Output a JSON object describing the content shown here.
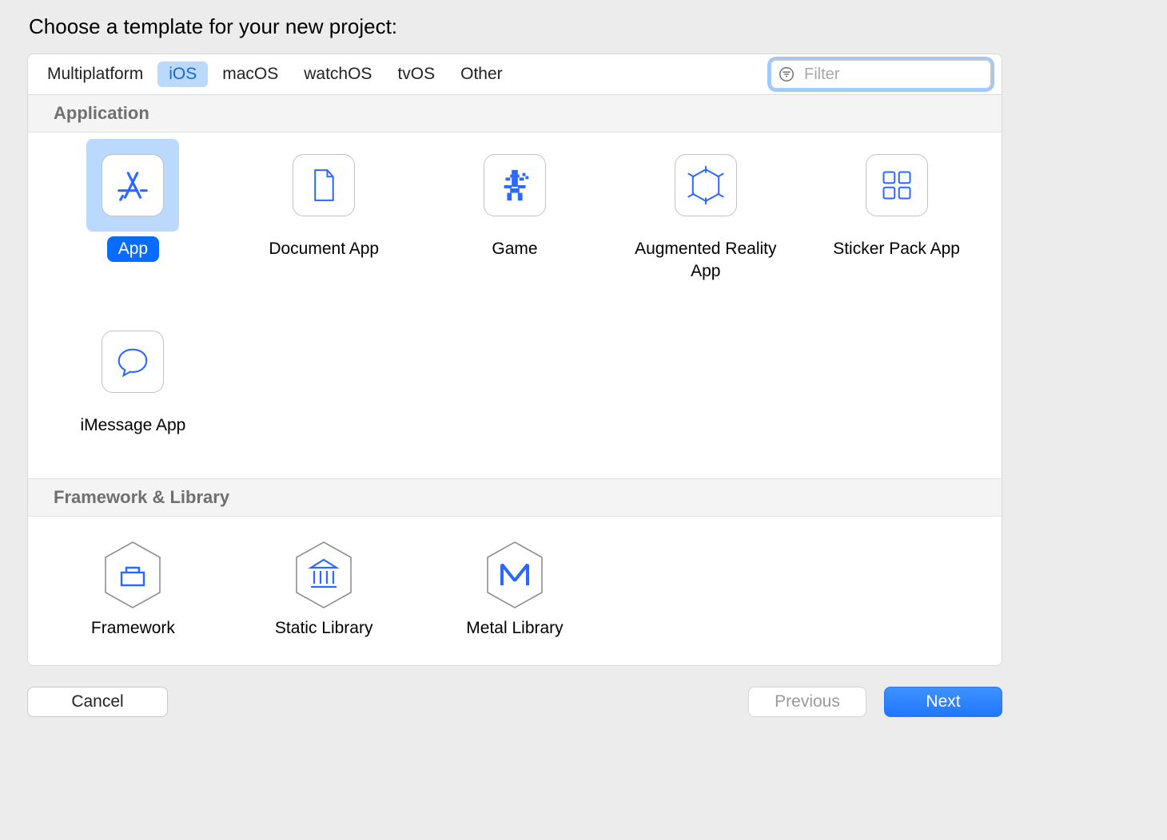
{
  "title": "Choose a template for your new project:",
  "tabs": [
    "Multiplatform",
    "iOS",
    "macOS",
    "watchOS",
    "tvOS",
    "Other"
  ],
  "active_tab_index": 1,
  "filter": {
    "placeholder": "Filter",
    "value": ""
  },
  "sections": {
    "application": {
      "title": "Application",
      "items": [
        {
          "label": "App",
          "icon": "app-store-icon",
          "selected": true
        },
        {
          "label": "Document App",
          "icon": "document-icon"
        },
        {
          "label": "Game",
          "icon": "game-icon"
        },
        {
          "label": "Augmented Reality App",
          "icon": "ar-icon"
        },
        {
          "label": "Sticker Pack App",
          "icon": "grid-icon"
        },
        {
          "label": "iMessage App",
          "icon": "chat-icon"
        }
      ]
    },
    "framework": {
      "title": "Framework & Library",
      "items": [
        {
          "label": "Framework",
          "icon": "framework-icon"
        },
        {
          "label": "Static Library",
          "icon": "library-icon"
        },
        {
          "label": "Metal Library",
          "icon": "metal-icon"
        }
      ]
    }
  },
  "buttons": {
    "cancel": "Cancel",
    "previous": "Previous",
    "next": "Next"
  }
}
